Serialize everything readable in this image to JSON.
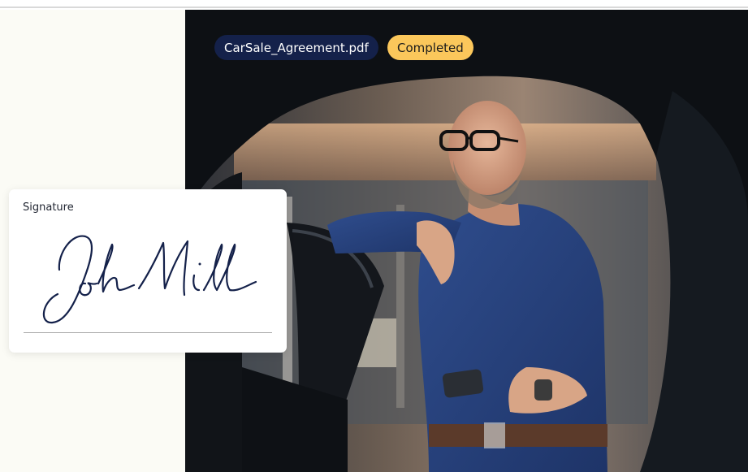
{
  "document": {
    "file_name": "CarSale_Agreement.pdf",
    "status": "Completed"
  },
  "signature": {
    "label": "Signature"
  },
  "colors": {
    "file_badge_bg": "#14214a",
    "status_badge_bg": "#fbc75b",
    "signature_ink": "#14214a",
    "panel_bg": "#fbfbf5"
  },
  "icons": [
    "signature-drawing"
  ]
}
